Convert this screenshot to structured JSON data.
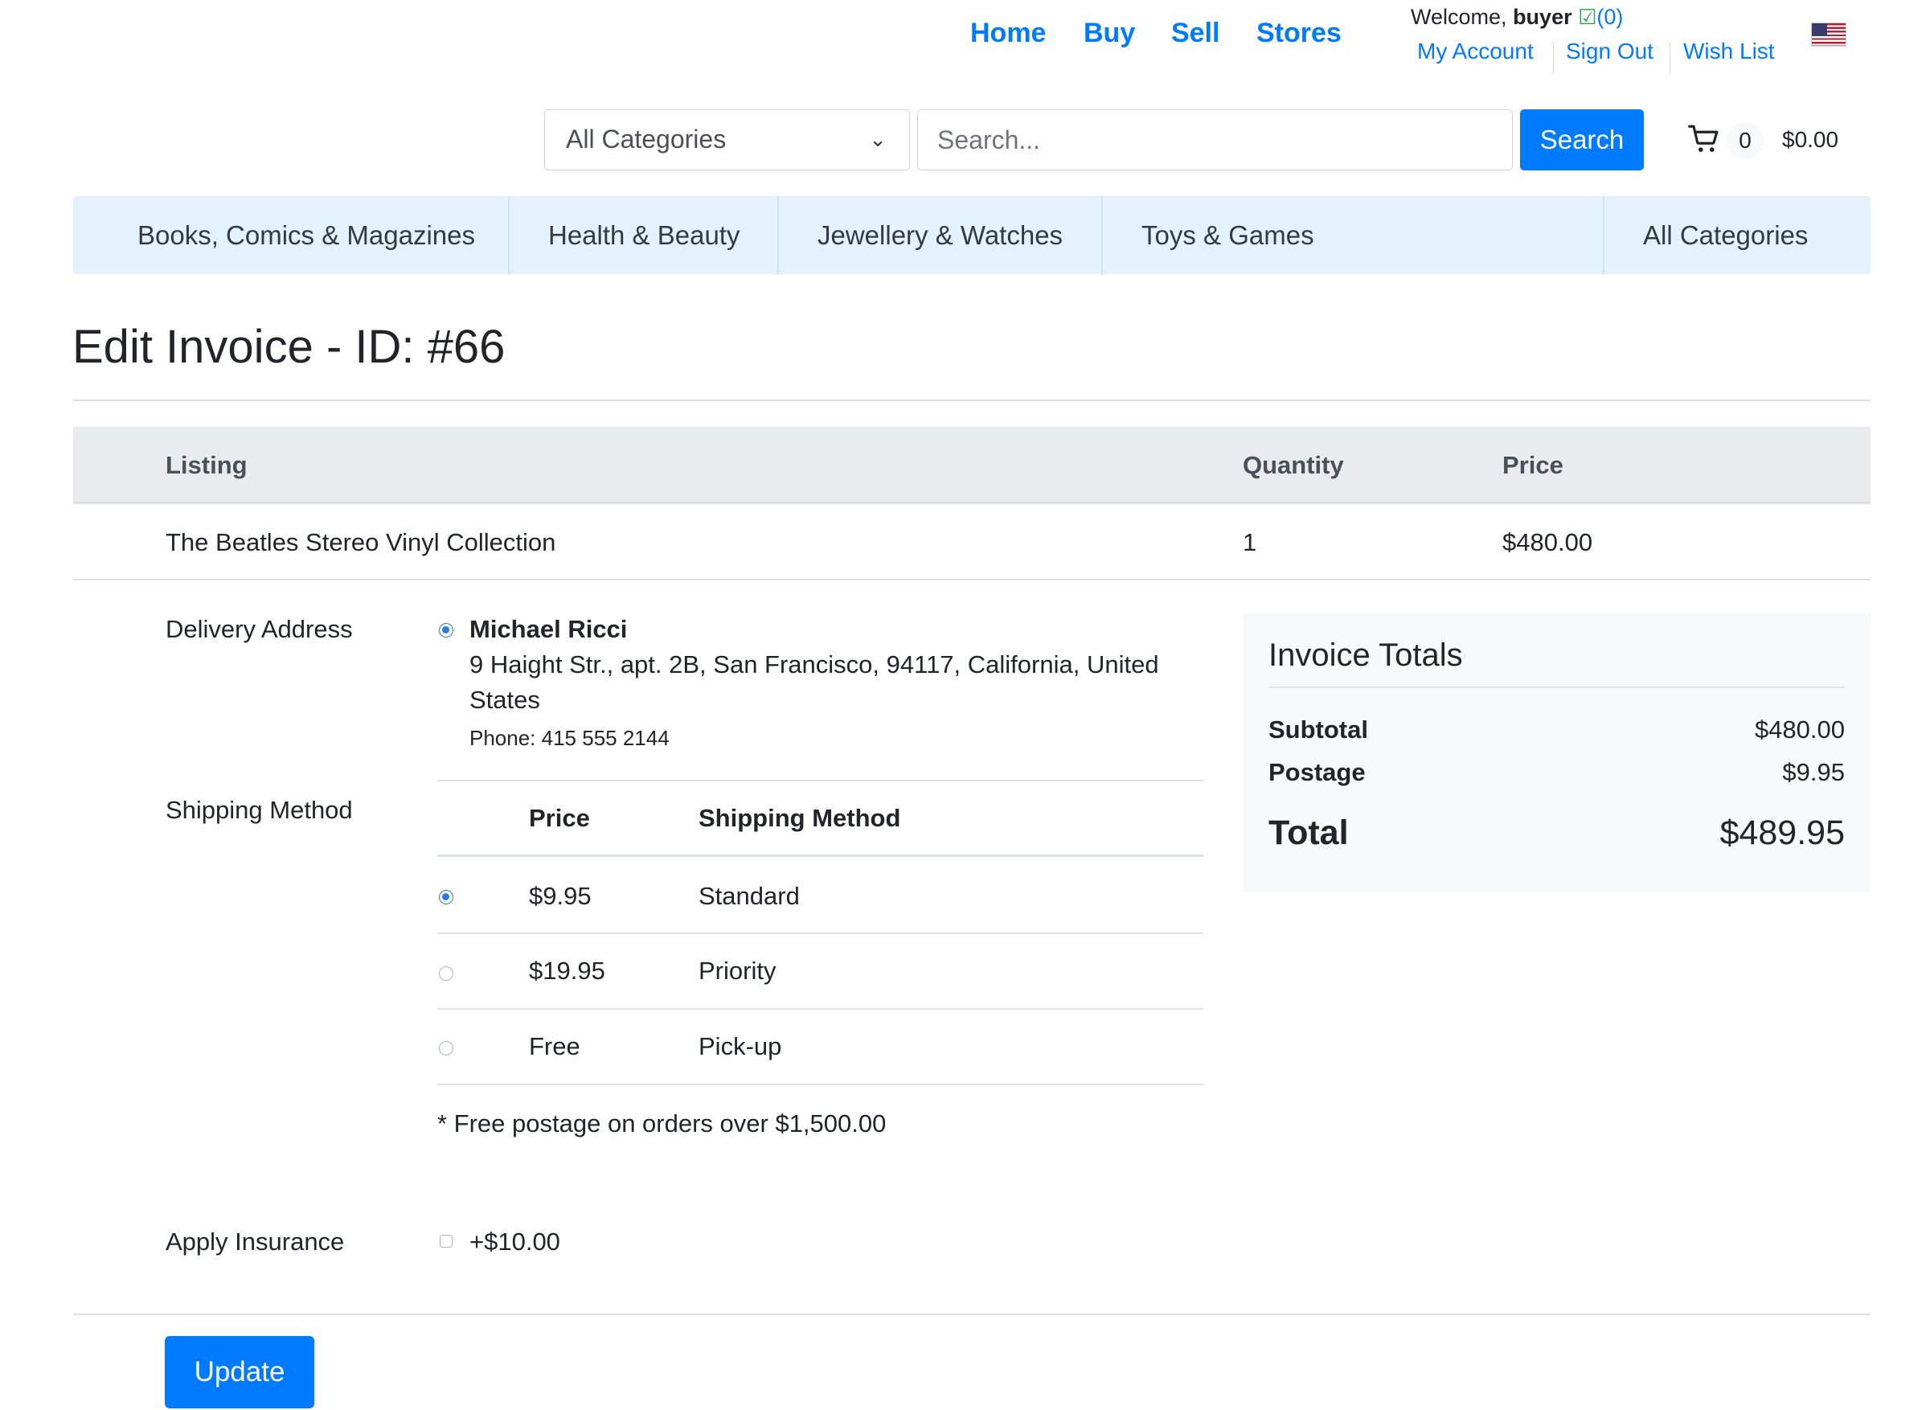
{
  "nav": {
    "home": "Home",
    "buy": "Buy",
    "sell": "Sell",
    "stores": "Stores"
  },
  "account": {
    "welcome_prefix": "Welcome,",
    "username": "buyer",
    "feedback_count": "(0)",
    "my_account": "My Account",
    "sign_out": "Sign Out",
    "wish_list": "Wish List",
    "flag_icon": "us-flag-icon"
  },
  "search": {
    "category_selected": "All Categories",
    "placeholder": "Search...",
    "button_label": "Search"
  },
  "cart": {
    "icon": "cart-icon",
    "count": "0",
    "total": "$0.00"
  },
  "categories": {
    "items": [
      "Books, Comics & Magazines",
      "Health & Beauty",
      "Jewellery & Watches",
      "Toys & Games"
    ],
    "all": "All Categories"
  },
  "page": {
    "title": "Edit Invoice - ID: #66"
  },
  "listing_table": {
    "headers": {
      "listing": "Listing",
      "quantity": "Quantity",
      "price": "Price"
    },
    "rows": [
      {
        "listing": "The Beatles Stereo Vinyl Collection",
        "quantity": "1",
        "price": "$480.00"
      }
    ]
  },
  "delivery": {
    "label": "Delivery Address",
    "name": "Michael Ricci",
    "address_line1": "9 Haight Str., apt. 2B, San Francisco, 94117, California, United",
    "address_line2": "States",
    "phone": "Phone: 415 555 2144",
    "selected": true
  },
  "shipping": {
    "label": "Shipping Method",
    "headers": {
      "price": "Price",
      "method": "Shipping Method"
    },
    "options": [
      {
        "price": "$9.95",
        "method": "Standard",
        "selected": true
      },
      {
        "price": "$19.95",
        "method": "Priority",
        "selected": false
      },
      {
        "price": "Free",
        "method": "Pick-up",
        "selected": false
      }
    ],
    "note": "* Free postage on orders over $1,500.00"
  },
  "insurance": {
    "label": "Apply Insurance",
    "value": "+$10.00",
    "checked": false
  },
  "totals": {
    "title": "Invoice Totals",
    "subtotal_label": "Subtotal",
    "subtotal": "$480.00",
    "postage_label": "Postage",
    "postage": "$9.95",
    "total_label": "Total",
    "total": "$489.95"
  },
  "actions": {
    "update": "Update"
  }
}
